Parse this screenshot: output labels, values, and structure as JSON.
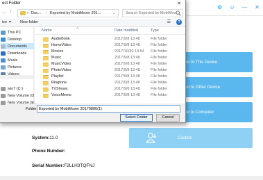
{
  "app": {
    "actions": [
      {
        "label": "ler to This Device"
      },
      {
        "label": "ler to Other Device"
      },
      {
        "label": "ler to Computer"
      },
      {
        "label": "Custom"
      }
    ],
    "info": {
      "system_label": "System:",
      "system_value": "11.0",
      "phone_label": "Phone Number:",
      "phone_value": "",
      "serial_label": "Serial Number:",
      "serial_value": "F2LLH3TQFNJ"
    },
    "accent": "#5bb8ef"
  },
  "dialog": {
    "title": "ect Folder",
    "path": {
      "crumb1": "Doc...",
      "crumb2": "Exported by MobiMover 201..."
    },
    "search_placeholder": "Search Exported by MobiMov...",
    "commands": {
      "organize": "ize",
      "new_folder": "New folder"
    },
    "nav_items": [
      {
        "label": "This PC",
        "icon": "pc-icon"
      },
      {
        "label": "Desktop",
        "icon": "desktop-icon"
      },
      {
        "label": "Documents",
        "icon": "documents-icon"
      },
      {
        "label": "Downloads",
        "icon": "downloads-icon"
      },
      {
        "label": "Music",
        "icon": "music-icon"
      },
      {
        "label": "Pictures",
        "icon": "pictures-icon"
      },
      {
        "label": "Videos",
        "icon": "videos-icon"
      },
      {
        "label": "win7 (C:)",
        "icon": "drive-icon"
      },
      {
        "label": "New Volume (D:)",
        "icon": "drive-icon"
      },
      {
        "label": "New Volume (E:)",
        "icon": "drive-icon"
      }
    ],
    "columns": {
      "name": "Name",
      "date": "Date modified",
      "type": "Type"
    },
    "files": [
      {
        "name": "AudioBook",
        "date": "2017/9/8 13:48",
        "type": "File folder"
      },
      {
        "name": "HomeVideo",
        "date": "2017/9/8 13:48",
        "type": "File folder"
      },
      {
        "name": "Movies",
        "date": "2017/10/30 13:54",
        "type": "File folder"
      },
      {
        "name": "Music",
        "date": "2017/9/8 13:48",
        "type": "File folder"
      },
      {
        "name": "MusicVideo",
        "date": "2017/9/8 13:48",
        "type": "File folder"
      },
      {
        "name": "PhotoVideo",
        "date": "2017/9/8 13:48",
        "type": "File folder"
      },
      {
        "name": "Playlist",
        "date": "2017/9/8 13:48",
        "type": "File folder"
      },
      {
        "name": "Ringtone",
        "date": "2017/9/8 13:48",
        "type": "File folder"
      },
      {
        "name": "TVShows",
        "date": "2017/9/8 13:48",
        "type": "File folder"
      },
      {
        "name": "VoiceMemo",
        "date": "2017/9/8 13:48",
        "type": "File folder"
      }
    ],
    "folder_label": "Folder:",
    "folder_value": "Exported by MobiMover 20170806(1)",
    "select_button": "Select Folder",
    "cancel_button": "Cancel"
  }
}
